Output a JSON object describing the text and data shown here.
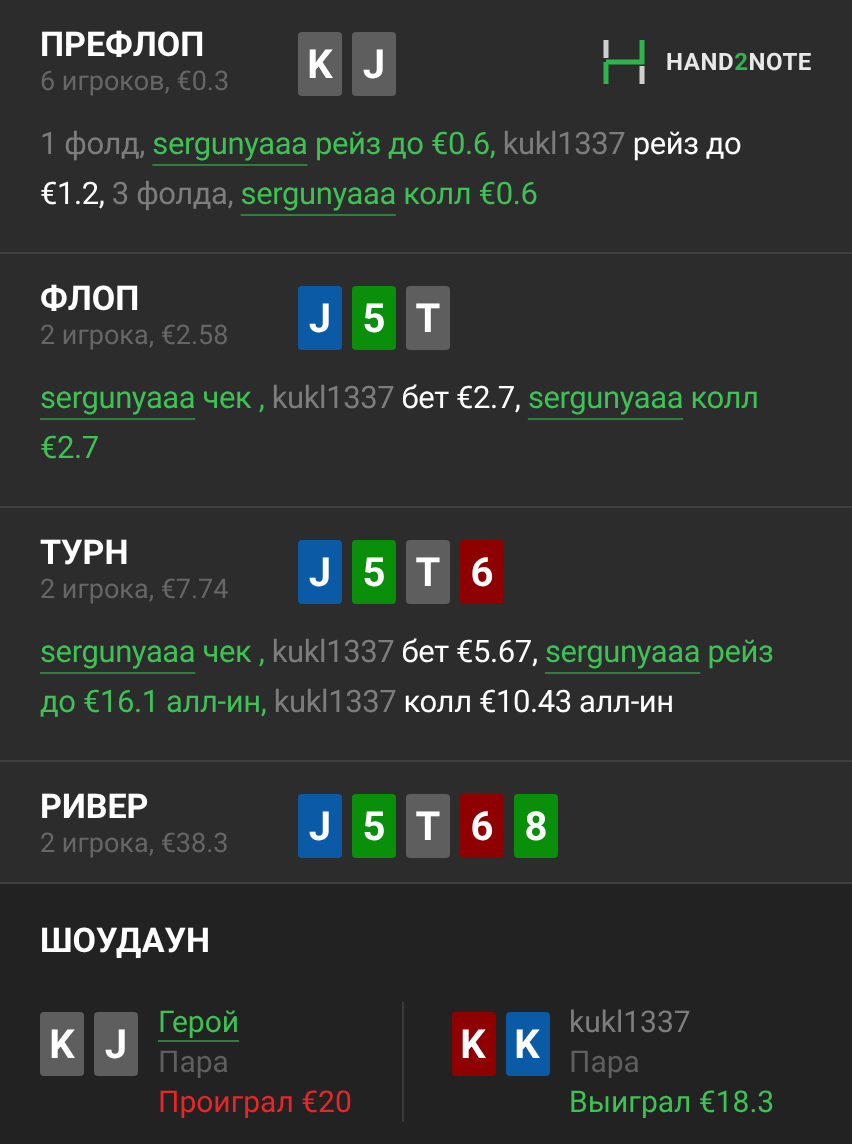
{
  "logo": {
    "parts": [
      "HAND",
      "2",
      "NOTE"
    ]
  },
  "streets": [
    {
      "title": "ПРЕФЛОП",
      "info": "6 игроков, €0.3",
      "cards": [
        {
          "rank": "K",
          "color": "#5e5e5e"
        },
        {
          "rank": "J",
          "color": "#5e5e5e"
        }
      ],
      "actions": [
        {
          "kind": "plain",
          "text": "1 фолд, "
        },
        {
          "kind": "hero",
          "text": "sergunyaaa"
        },
        {
          "kind": "hero_action",
          "text": " рейз до €0.6, "
        },
        {
          "kind": "villain",
          "text": "kukl1337"
        },
        {
          "kind": "villain_action",
          "text": " рейз до €1.2, "
        },
        {
          "kind": "plain",
          "text": "3 фолда, "
        },
        {
          "kind": "hero",
          "text": "sergunyaaa"
        },
        {
          "kind": "hero_action",
          "text": " колл €0.6"
        }
      ]
    },
    {
      "title": "ФЛОП",
      "info": "2 игрока, €2.58",
      "cards": [
        {
          "rank": "J",
          "color": "#0b5aa6"
        },
        {
          "rank": "5",
          "color": "#0a8f0a"
        },
        {
          "rank": "T",
          "color": "#5e5e5e"
        }
      ],
      "actions": [
        {
          "kind": "hero",
          "text": "sergunyaaa"
        },
        {
          "kind": "hero_action",
          "text": " чек , "
        },
        {
          "kind": "villain",
          "text": "kukl1337"
        },
        {
          "kind": "villain_action",
          "text": " бет €2.7, "
        },
        {
          "kind": "hero",
          "text": "sergunyaaa"
        },
        {
          "kind": "hero_action",
          "text": " колл €2.7"
        }
      ]
    },
    {
      "title": "ТУРН",
      "info": "2 игрока, €7.74",
      "cards": [
        {
          "rank": "J",
          "color": "#0b5aa6"
        },
        {
          "rank": "5",
          "color": "#0a8f0a"
        },
        {
          "rank": "T",
          "color": "#5e5e5e"
        },
        {
          "rank": "6",
          "color": "#8f0000"
        }
      ],
      "actions": [
        {
          "kind": "hero",
          "text": "sergunyaaa"
        },
        {
          "kind": "hero_action",
          "text": " чек , "
        },
        {
          "kind": "villain",
          "text": "kukl1337"
        },
        {
          "kind": "villain_action",
          "text": " бет €5.67, "
        },
        {
          "kind": "hero",
          "text": "sergunyaaa"
        },
        {
          "kind": "hero_action",
          "text": " рейз до €16.1 алл-ин, "
        },
        {
          "kind": "villain",
          "text": "kukl1337"
        },
        {
          "kind": "villain_action",
          "text": " колл €10.43 алл-ин"
        }
      ]
    },
    {
      "title": "РИВЕР",
      "info": "2 игрока, €38.3",
      "cards": [
        {
          "rank": "J",
          "color": "#0b5aa6"
        },
        {
          "rank": "5",
          "color": "#0a8f0a"
        },
        {
          "rank": "T",
          "color": "#5e5e5e"
        },
        {
          "rank": "6",
          "color": "#8f0000"
        },
        {
          "rank": "8",
          "color": "#0a8f0a"
        }
      ]
    }
  ],
  "showdown": {
    "title": "ШОУДАУН",
    "players": [
      {
        "kind": "hero",
        "name": "Герой",
        "hand": "Пара",
        "result": "Проиграл €20",
        "won": false,
        "cards": [
          {
            "rank": "K",
            "color": "#5e5e5e"
          },
          {
            "rank": "J",
            "color": "#5e5e5e"
          }
        ]
      },
      {
        "kind": "villain",
        "name": "kukl1337",
        "hand": "Пара",
        "result": "Выиграл €18.3",
        "won": true,
        "cards": [
          {
            "rank": "K",
            "color": "#8f0000"
          },
          {
            "rank": "K",
            "color": "#0b5aa6"
          }
        ]
      }
    ]
  }
}
